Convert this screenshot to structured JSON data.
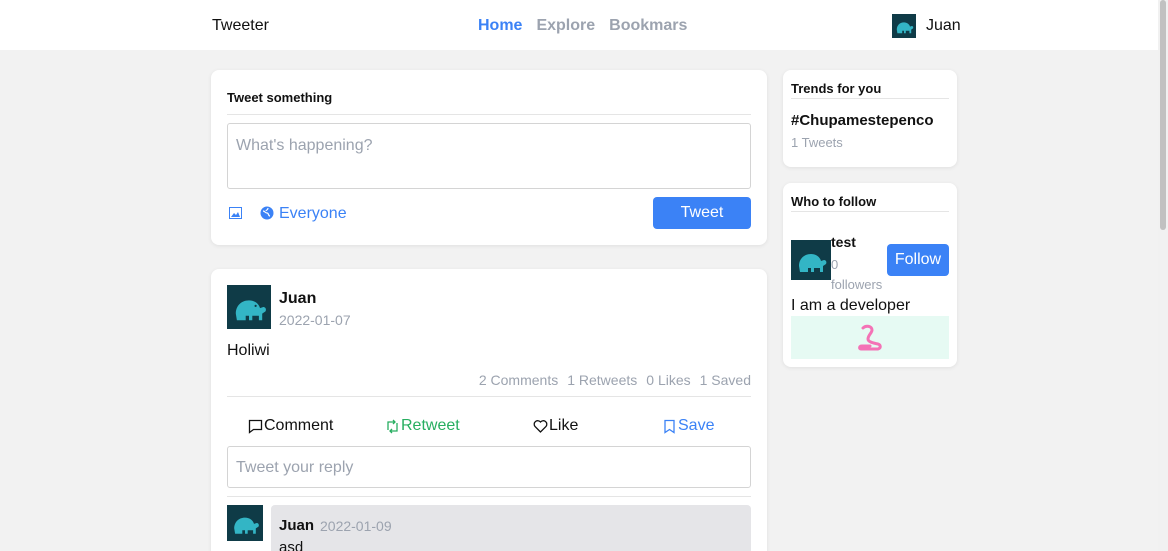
{
  "header": {
    "brand": "Tweeter",
    "nav": [
      {
        "label": "Home",
        "active": true
      },
      {
        "label": "Explore",
        "active": false
      },
      {
        "label": "Bookmars",
        "active": false
      }
    ],
    "user_name": "Juan",
    "user_avatar_icon": "elephant-avatar-icon"
  },
  "compose": {
    "title": "Tweet something",
    "placeholder": "What's happening?",
    "image_icon": "image-icon",
    "visibility_icon": "globe-icon",
    "visibility_label": "Everyone",
    "tweet_button": "Tweet"
  },
  "post": {
    "author": "Juan",
    "date": "2022-01-07",
    "body": "Holiwi",
    "stats": {
      "comments": "2 Comments",
      "retweets": "1 Retweets",
      "likes": "0 Likes",
      "saved": "1 Saved"
    },
    "actions": {
      "comment": "Comment",
      "retweet": "Retweet",
      "like": "Like",
      "save": "Save"
    },
    "reply_placeholder": "Tweet your reply",
    "comment": {
      "author": "Juan",
      "date": "2022-01-09",
      "text": "asd"
    }
  },
  "trends": {
    "title": "Trends for you",
    "items": [
      {
        "tag": "#Chupamestepenco",
        "count": "1 Tweets"
      }
    ]
  },
  "who_to_follow": {
    "title": "Who to follow",
    "user": {
      "name": "test",
      "followers": "0 followers",
      "bio": "I am a developer",
      "follow_button": "Follow"
    }
  },
  "colors": {
    "accent": "#3b82f6",
    "retweet": "#27ae60",
    "muted": "#9ca3af",
    "avatar_bg": "#0f3b47",
    "page_bg": "#f2f2f2"
  }
}
